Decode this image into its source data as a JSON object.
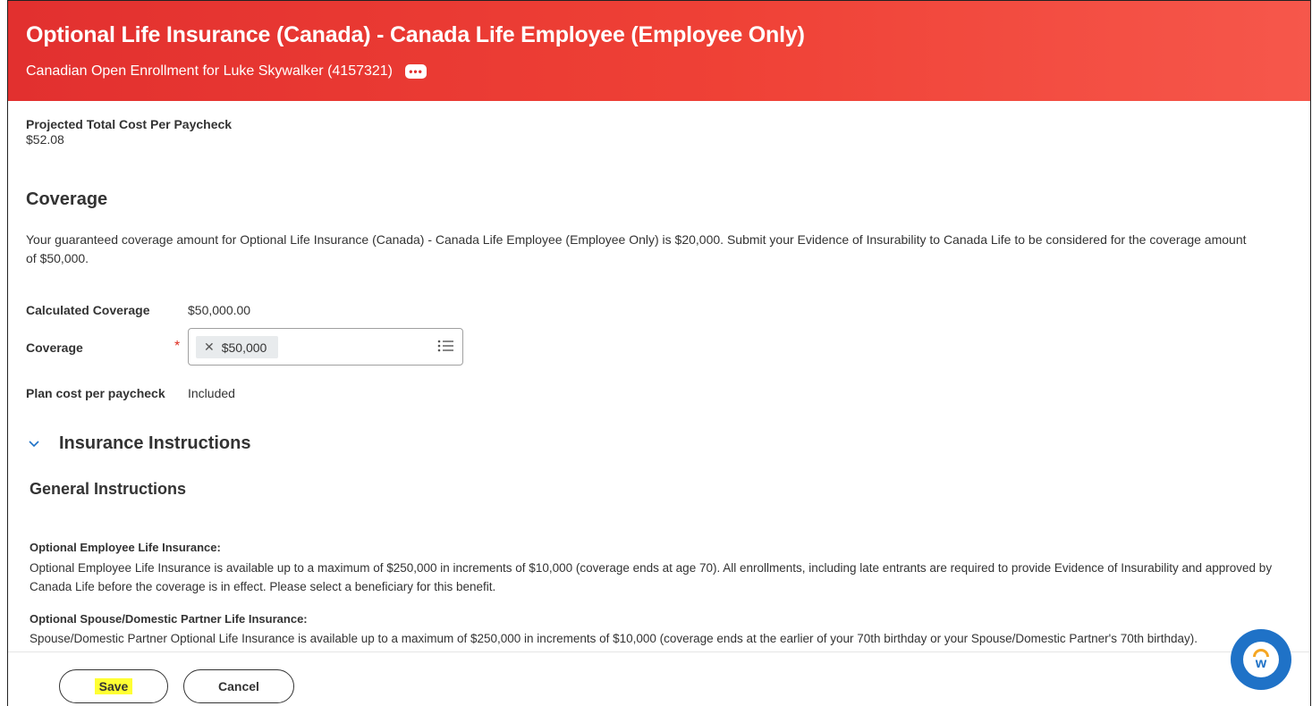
{
  "header": {
    "title": "Optional Life Insurance (Canada) - Canada Life Employee (Employee Only)",
    "subtitle": "Canadian Open Enrollment for Luke Skywalker (4157321)",
    "related_actions": "•••"
  },
  "projected": {
    "label": "Projected Total Cost Per Paycheck",
    "value": "$52.08"
  },
  "coverage_section": {
    "heading": "Coverage",
    "description": "Your guaranteed coverage amount for Optional Life Insurance (Canada) - Canada Life Employee (Employee Only) is $20,000. Submit your Evidence of Insurability to Canada Life to be considered for the coverage amount of $50,000.",
    "calculated_label": "Calculated Coverage",
    "calculated_value": "$50,000.00",
    "coverage_label": "Coverage",
    "required_marker": "*",
    "coverage_selected": "$50,000",
    "plan_cost_label": "Plan cost per paycheck",
    "plan_cost_value": "Included"
  },
  "instructions": {
    "heading": "Insurance Instructions",
    "general_heading": "General Instructions",
    "items": [
      {
        "title": "Optional Employee Life Insurance:",
        "body": "Optional Employee Life Insurance is available up to a maximum of $250,000 in increments of $10,000 (coverage ends at age 70). All enrollments, including late entrants are required to provide Evidence of Insurability and approved by Canada Life before the coverage is in effect. Please select a beneficiary for this benefit."
      },
      {
        "title": "Optional Spouse/Domestic Partner Life Insurance:",
        "body": "Spouse/Domestic Partner Optional Life Insurance is available up to a maximum of $250,000 in increments of $10,000 (coverage ends at the earlier of your 70th birthday or your Spouse/Domestic Partner's 70th birthday)."
      }
    ]
  },
  "footer": {
    "save_label": "Save",
    "cancel_label": "Cancel"
  },
  "assistant": {
    "icon": "workday-assistant-icon",
    "letter": "w"
  },
  "colors": {
    "header_red": "#e2302f",
    "required_red": "#de2e21",
    "assistant_blue": "#1f72c7",
    "save_highlight": "#ffff33"
  }
}
